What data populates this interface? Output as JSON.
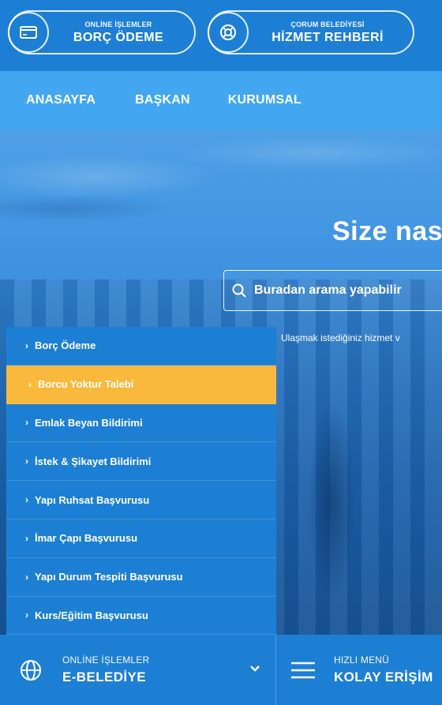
{
  "top": {
    "pill1": {
      "small": "ONLİNE İŞLEMLER",
      "big": "BORÇ ÖDEME",
      "icon": "card-icon"
    },
    "pill2": {
      "small": "ÇORUM BELEDİYESİ",
      "big": "HİZMET REHBERİ",
      "icon": "lifebuoy-icon"
    }
  },
  "nav": {
    "items": [
      "ANASAYFA",
      "BAŞKAN",
      "KURUMSAL"
    ]
  },
  "hero": {
    "title": "Size nas",
    "search_placeholder": "Buradan arama yapabilir",
    "hint": "Ulaşmak istediğiniz hizmet v"
  },
  "sidemenu": {
    "items": [
      "Borç Ödeme",
      "Borcu Yoktur Talebi",
      "Emlak Beyan Bildirimi",
      "İstek & Şikayet Bildirimi",
      "Yapı Ruhsat Başvurusu",
      "İmar Çapı Başvurusu",
      "Yapı Durum Tespiti Başvurusu",
      "Kurs/Eğitim Başvurusu"
    ],
    "active_index": 1
  },
  "bottom": {
    "left": {
      "small": "ONLİNE İŞLEMLER",
      "big": "E-BELEDİYE"
    },
    "right": {
      "small": "HIZLI MENÜ",
      "big": "KOLAY ERİŞİM"
    }
  },
  "colors": {
    "primary": "#1d7fd3",
    "nav": "#42a7f0",
    "accent": "#f8b93c"
  }
}
